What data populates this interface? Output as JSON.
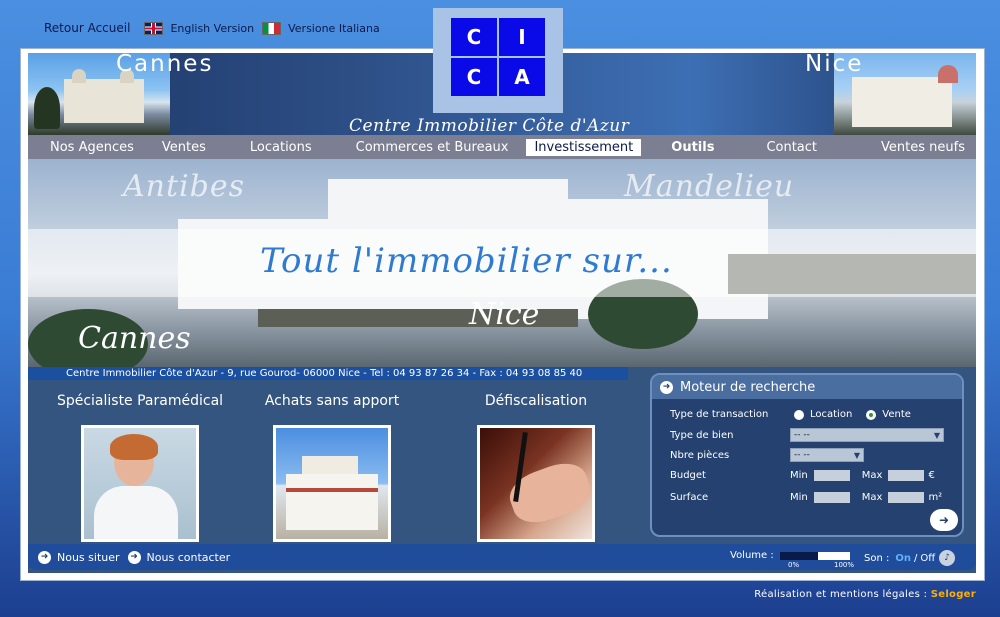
{
  "top_links": {
    "home": "Retour Accueil",
    "english": "English Version",
    "italian": "Versione Italiana"
  },
  "logo": {
    "letters": [
      "C",
      "I",
      "C",
      "A"
    ],
    "color": "#0a0ae8"
  },
  "header": {
    "city_left": "Cannes",
    "city_right": "Nice",
    "brand": "Centre Immobilier Côte d'Azur"
  },
  "nav": {
    "items": [
      {
        "label": "Nos Agences"
      },
      {
        "label": "Ventes"
      },
      {
        "label": "Locations"
      },
      {
        "label": "Commerces et Bureaux"
      },
      {
        "label": "Investissement"
      },
      {
        "label": "Outils"
      },
      {
        "label": "Contact"
      },
      {
        "label": "Ventes neufs"
      }
    ],
    "active": "Investissement"
  },
  "banner": {
    "antibes": "Antibes",
    "mandelieu": "Mandelieu",
    "tagline": "Tout l'immobilier sur...",
    "nice": "Nice",
    "cannes": "Cannes"
  },
  "address": "Centre Immobilier Côte d'Azur - 9, rue Gourod- 06000 Nice - Tel : 04 93 87 26 34 - Fax : 04 93 08 85 40",
  "features": [
    {
      "title": "Spécialiste Paramédical"
    },
    {
      "title": "Achats sans apport"
    },
    {
      "title": "Défiscalisation"
    }
  ],
  "search": {
    "title": "Moteur de recherche",
    "transaction_label": "Type de transaction",
    "option_location": "Location",
    "option_vente": "Vente",
    "selected_transaction": "Vente",
    "type_bien_label": "Type de bien",
    "type_bien_value": "-- --",
    "pieces_label": "Nbre pièces",
    "pieces_value": "-- --",
    "budget_label": "Budget",
    "surface_label": "Surface",
    "min": "Min",
    "max": "Max",
    "currency": "€",
    "unit": "m²"
  },
  "footer": {
    "nous_situer": "Nous situer",
    "nous_contacter": "Nous contacter",
    "volume_label": "Volume :",
    "vol_min": "0%",
    "vol_max": "100%",
    "volume_level": 0.55,
    "son_label": "Son :",
    "son_on": "On",
    "son_sep": "/",
    "son_off": "Off"
  },
  "credits": {
    "text": "Réalisation et mentions légales :",
    "link": "Seloger"
  }
}
